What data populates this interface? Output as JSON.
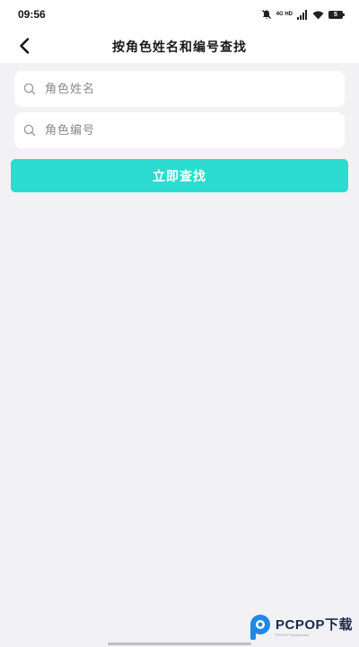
{
  "status_bar": {
    "time": "09:56",
    "network_label": "4G HD",
    "battery_level": "5"
  },
  "header": {
    "title": "按角色姓名和编号查找",
    "back_icon": "chevron-left-icon"
  },
  "form": {
    "name_field": {
      "placeholder": "角色姓名",
      "value": "",
      "icon": "search-icon"
    },
    "id_field": {
      "placeholder": "角色编号",
      "value": "",
      "icon": "search-icon"
    },
    "submit_label": "立即查找"
  },
  "watermark": {
    "text": "PCPOP下载",
    "subtext": "PCPOP Download"
  },
  "colors": {
    "accent": "#2ddcd0",
    "background": "#f2f2f5",
    "surface": "#ffffff",
    "text": "#1a1a1a",
    "placeholder": "#8a8a8a"
  }
}
